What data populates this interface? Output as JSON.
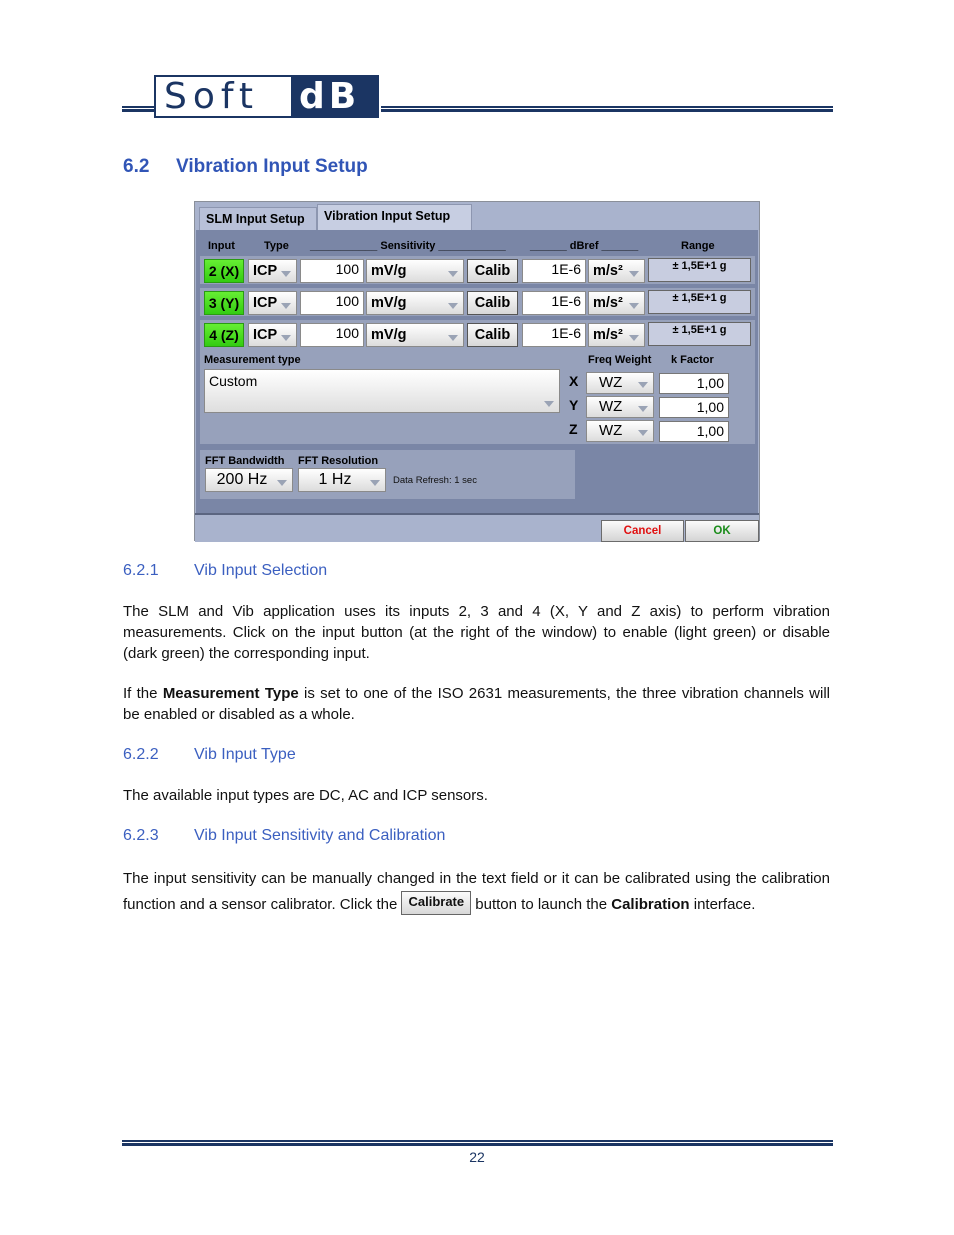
{
  "header": {
    "logo_left": "Soft",
    "logo_right": "dB"
  },
  "section": {
    "number": "6.2",
    "title": "Vibration Input Setup"
  },
  "dialog": {
    "tabs": [
      {
        "label": "SLM Input Setup",
        "active": false
      },
      {
        "label": "Vibration Input Setup",
        "active": true
      }
    ],
    "column_headers": {
      "input": "Input",
      "type": "Type",
      "sensitivity": "___________ Sensitivity ___________",
      "dbref": "______ dBref ______",
      "range": "Range"
    },
    "rows": [
      {
        "input": "2 (X)",
        "type": "ICP",
        "sensitivity": "100",
        "sens_unit": "mV/g",
        "calib": "Calib",
        "dbref": "1E-6",
        "dbref_unit": "m/s²",
        "range": "± 1,5E+1 g"
      },
      {
        "input": "3 (Y)",
        "type": "ICP",
        "sensitivity": "100",
        "sens_unit": "mV/g",
        "calib": "Calib",
        "dbref": "1E-6",
        "dbref_unit": "m/s²",
        "range": "± 1,5E+1 g"
      },
      {
        "input": "4 (Z)",
        "type": "ICP",
        "sensitivity": "100",
        "sens_unit": "mV/g",
        "calib": "Calib",
        "dbref": "1E-6",
        "dbref_unit": "m/s²",
        "range": "± 1,5E+1 g"
      }
    ],
    "input_enabled_color": "#44dd22",
    "measurement_type": {
      "label": "Measurement type",
      "value": "Custom"
    },
    "freq_weight_label": "Freq Weight",
    "k_factor_label": "k Factor",
    "axes": [
      {
        "axis": "X",
        "freq_weight": "WZ",
        "k_factor": "1,00"
      },
      {
        "axis": "Y",
        "freq_weight": "WZ",
        "k_factor": "1,00"
      },
      {
        "axis": "Z",
        "freq_weight": "WZ",
        "k_factor": "1,00"
      }
    ],
    "fft": {
      "bandwidth_label": "FFT Bandwidth",
      "bandwidth_value": "200 Hz",
      "resolution_label": "FFT Resolution",
      "resolution_value": "1 Hz",
      "data_refresh": "Data Refresh: 1 sec"
    },
    "buttons": {
      "cancel": "Cancel",
      "ok": "OK"
    }
  },
  "subsections": [
    {
      "number": "6.2.1",
      "title": "Vib Input Selection",
      "paragraphs": [
        "The SLM and Vib application uses its inputs 2, 3 and 4 (X, Y and Z axis) to perform vibration measurements. Click on the input button (at the right of the window) to enable (light green) or disable (dark green) the corresponding input.",
        {
          "before": "If the ",
          "bold": "Measurement Type",
          "after": " is set to one of the ISO 2631 measurements, the three vibration channels will be enabled or disabled as a whole."
        }
      ]
    },
    {
      "number": "6.2.2",
      "title": "Vib Input Type",
      "paragraphs": [
        "The available input types are DC, AC and ICP sensors."
      ]
    },
    {
      "number": "6.2.3",
      "title": "Vib Input Sensitivity and Calibration",
      "paragraphs": [
        {
          "before": "The input sensitivity can be manually changed in the text field or it can be calibrated using the calibration function and a sensor calibrator. Click the ",
          "button": "Calibrate",
          "middle": " button to launch the ",
          "bold": "Calibration",
          "after": " interface."
        }
      ]
    }
  ],
  "footer": {
    "page_number": "22"
  }
}
